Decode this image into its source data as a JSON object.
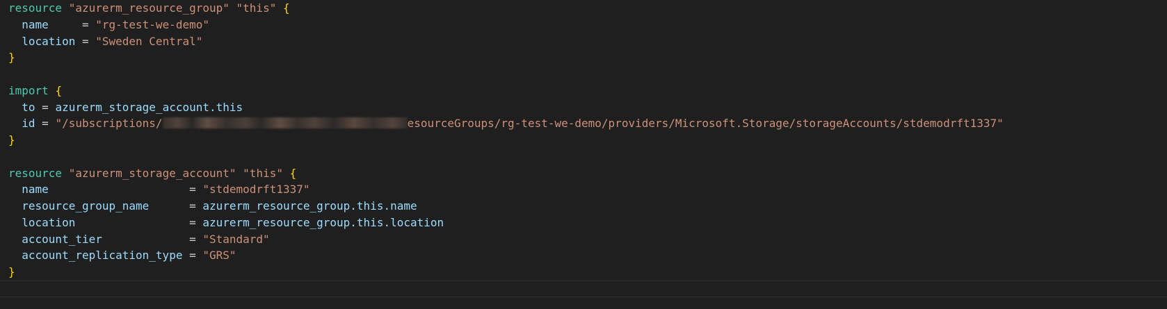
{
  "editor": {
    "language": "terraform",
    "blurred_region_note": "",
    "blocks": {
      "rg": {
        "kw": "resource",
        "type": "\"azurerm_resource_group\"",
        "name": "\"this\"",
        "open": "{",
        "close": "}",
        "attrs": [
          {
            "key": "name",
            "pad": "     ",
            "eq": "= ",
            "value": "\"rg-test-we-demo\""
          },
          {
            "key": "location",
            "pad": " ",
            "eq": "= ",
            "value": "\"Sweden Central\""
          }
        ]
      },
      "import": {
        "kw": "import",
        "open": "{",
        "close": "}",
        "to_key": "to",
        "to_eq": " = ",
        "to_value": "azurerm_storage_account.this",
        "id_key": "id",
        "id_eq": " = ",
        "id_prefix": "\"/subscriptions/",
        "id_suffix": "esourceGroups/rg-test-we-demo/providers/Microsoft.Storage/storageAccounts/stdemodrft1337\""
      },
      "sa": {
        "kw": "resource",
        "type": "\"azurerm_storage_account\"",
        "name": "\"this\"",
        "open": "{",
        "close": "}",
        "attrs": [
          {
            "key": "name",
            "pad": "                     ",
            "eq": "= ",
            "value": "\"stdemodrft1337\"",
            "kind": "str"
          },
          {
            "key": "resource_group_name",
            "pad": "      ",
            "eq": "= ",
            "value": "azurerm_resource_group.this.name",
            "kind": "ident"
          },
          {
            "key": "location",
            "pad": "                 ",
            "eq": "= ",
            "value": "azurerm_resource_group.this.location",
            "kind": "ident"
          },
          {
            "key": "account_tier",
            "pad": "             ",
            "eq": "= ",
            "value": "\"Standard\"",
            "kind": "str"
          },
          {
            "key": "account_replication_type",
            "pad": " ",
            "eq": "= ",
            "value": "\"GRS\"",
            "kind": "str"
          }
        ]
      }
    }
  }
}
